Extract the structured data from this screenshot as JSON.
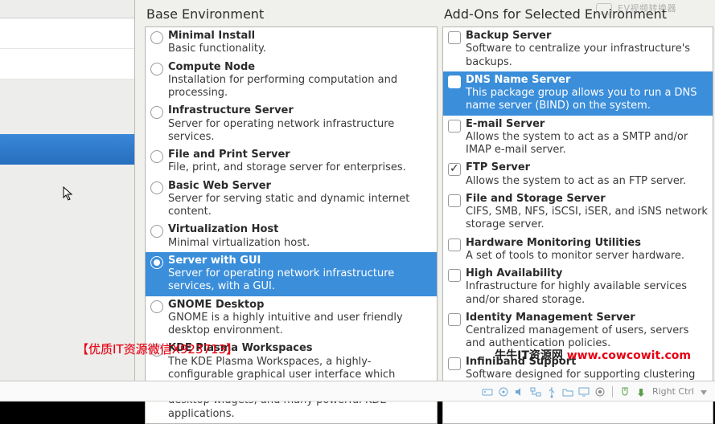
{
  "headers": {
    "base": "Base Environment",
    "addons": "Add-Ons for Selected Environment"
  },
  "base_items": [
    {
      "name": "Minimal Install",
      "desc": "Basic functionality.",
      "selected": false,
      "checked": false
    },
    {
      "name": "Compute Node",
      "desc": "Installation for performing computation and processing.",
      "selected": false,
      "checked": false
    },
    {
      "name": "Infrastructure Server",
      "desc": "Server for operating network infrastructure services.",
      "selected": false,
      "checked": false
    },
    {
      "name": "File and Print Server",
      "desc": "File, print, and storage server for enterprises.",
      "selected": false,
      "checked": false
    },
    {
      "name": "Basic Web Server",
      "desc": "Server for serving static and dynamic internet content.",
      "selected": false,
      "checked": false
    },
    {
      "name": "Virtualization Host",
      "desc": "Minimal virtualization host.",
      "selected": false,
      "checked": false
    },
    {
      "name": "Server with GUI",
      "desc": "Server for operating network infrastructure services, with a GUI.",
      "selected": true,
      "checked": true
    },
    {
      "name": "GNOME Desktop",
      "desc": "GNOME is a highly intuitive and user friendly desktop environment.",
      "selected": false,
      "checked": false
    },
    {
      "name": "KDE Plasma Workspaces",
      "desc": "The KDE Plasma Workspaces, a highly-configurable graphical user interface which includes a panel, desktop, system icons and desktop widgets, and many powerful KDE applications.",
      "selected": false,
      "checked": false
    }
  ],
  "addon_items": [
    {
      "name": "Backup Server",
      "desc": "Software to centralize your infrastructure's backups.",
      "selected": false,
      "checked": false
    },
    {
      "name": "DNS Name Server",
      "desc": "This package group allows you to run a DNS name server (BIND) on the system.",
      "selected": true,
      "checked": true
    },
    {
      "name": "E-mail Server",
      "desc": "Allows the system to act as a SMTP and/or IMAP e-mail server.",
      "selected": false,
      "checked": false
    },
    {
      "name": "FTP Server",
      "desc": "Allows the system to act as an FTP server.",
      "selected": false,
      "checked": true
    },
    {
      "name": "File and Storage Server",
      "desc": "CIFS, SMB, NFS, iSCSI, iSER, and iSNS network storage server.",
      "selected": false,
      "checked": false
    },
    {
      "name": "Hardware Monitoring Utilities",
      "desc": "A set of tools to monitor server hardware.",
      "selected": false,
      "checked": false
    },
    {
      "name": "High Availability",
      "desc": "Infrastructure for highly available services and/or shared storage.",
      "selected": false,
      "checked": false
    },
    {
      "name": "Identity Management Server",
      "desc": "Centralized management of users, servers and authentication policies.",
      "selected": false,
      "checked": false
    },
    {
      "name": "Infiniband Support",
      "desc": "Software designed for supporting clustering and grid",
      "selected": false,
      "checked": false
    }
  ],
  "statusbar": {
    "right_ctrl": "Right Ctrl"
  },
  "watermarks": {
    "red_left": "【优质IT资源微信X923713】",
    "bottom_right_a": "牛牛IT资源网 ",
    "bottom_right_b": "www.cowcowit.com",
    "top_right": "EV视频转换器"
  }
}
